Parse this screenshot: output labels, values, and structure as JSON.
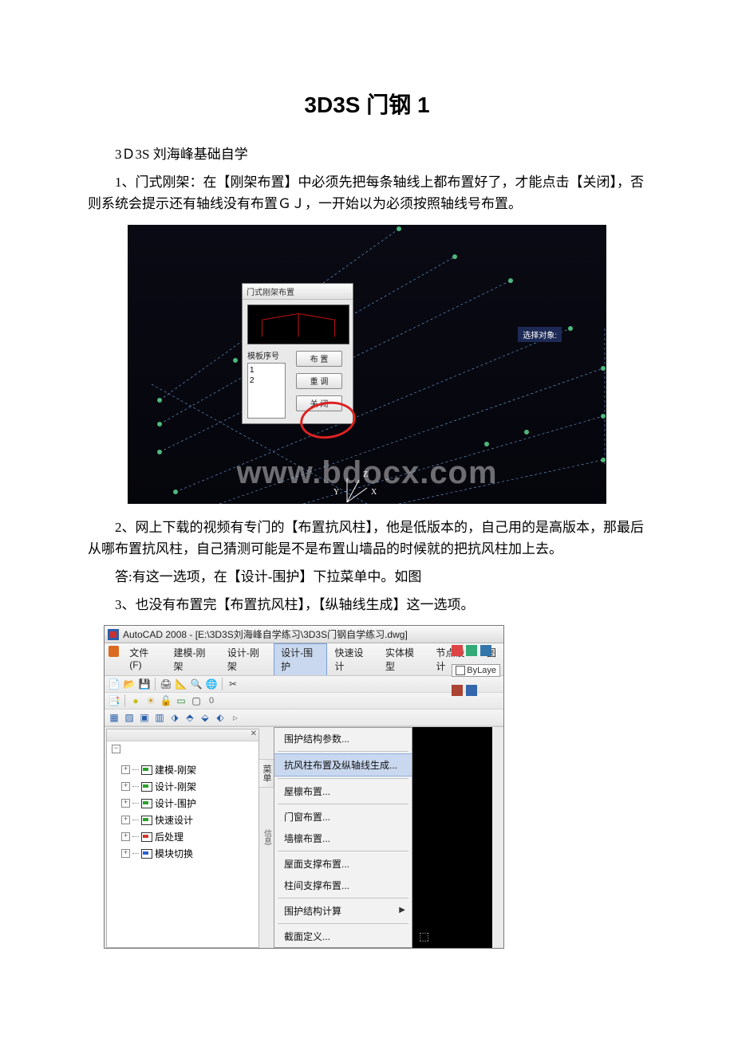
{
  "title": "3D3S 门钢 1",
  "p1": "3Ｄ3S 刘海峰基础自学",
  "p2": "1、门式刚架：在【刚架布置】中必须先把每条轴线上都布置好了，才能点击【关闭】，否则系统会提示还有轴线没有布置ＧＪ，一开始以为必须按照轴线号布置。",
  "p3": "2、网上下载的视频有专门的【布置抗风柱】，他是低版本的，自己用的是高版本，那最后从哪布置抗风柱，自己猜测可能是不是布置山墙品的时候就的把抗风柱加上去。",
  "p4": "答:有这一选项，在【设计-围护】下拉菜单中。如图",
  "p5": "3、也没有布置完【布置抗风柱】，【纵轴线生成】这一选项。",
  "shot1": {
    "dialog_title": "门式刚架布置",
    "list_label": "模板序号",
    "items": [
      "1",
      "2"
    ],
    "btn_place": "布 置",
    "btn_refresh": "重 调",
    "btn_close": "关 闭",
    "tag": "选择对象:",
    "watermark": "www.bdocx.com"
  },
  "shot2": {
    "app_title": "AutoCAD 2008 - [E:\\3D3S刘海峰自学练习\\3D3S门钢自学练习.dwg]",
    "menu": [
      "文件(F)",
      "建模-刚架",
      "设计-刚架",
      "设计-围护",
      "快速设计",
      "实体模型",
      "节点设计",
      "图"
    ],
    "menu_active_index": 3,
    "bylayer": "ByLaye",
    "tree": [
      {
        "label": "建模-刚架",
        "color": "green"
      },
      {
        "label": "设计-刚架",
        "color": "green"
      },
      {
        "label": "设计-围护",
        "color": "green"
      },
      {
        "label": "快速设计",
        "color": "green"
      },
      {
        "label": "后处理",
        "color": "red"
      },
      {
        "label": "模块切换",
        "color": "blue"
      }
    ],
    "vtab": "菜单",
    "vtab2": "信息",
    "dropdown": [
      {
        "text": "围护结构参数...",
        "type": "item"
      },
      {
        "type": "sep"
      },
      {
        "text": "抗风柱布置及纵轴线生成...",
        "type": "item",
        "hl": true
      },
      {
        "type": "sep"
      },
      {
        "text": "屋檩布置...",
        "type": "item"
      },
      {
        "type": "sep"
      },
      {
        "text": "门窗布置...",
        "type": "item"
      },
      {
        "text": "墙檩布置...",
        "type": "item"
      },
      {
        "type": "sep"
      },
      {
        "text": "屋面支撑布置...",
        "type": "item"
      },
      {
        "text": "柱间支撑布置...",
        "type": "item"
      },
      {
        "type": "sep"
      },
      {
        "text": "围护结构计算",
        "type": "item",
        "arrow": true
      },
      {
        "type": "sep"
      },
      {
        "text": "截面定义...",
        "type": "item"
      }
    ]
  }
}
